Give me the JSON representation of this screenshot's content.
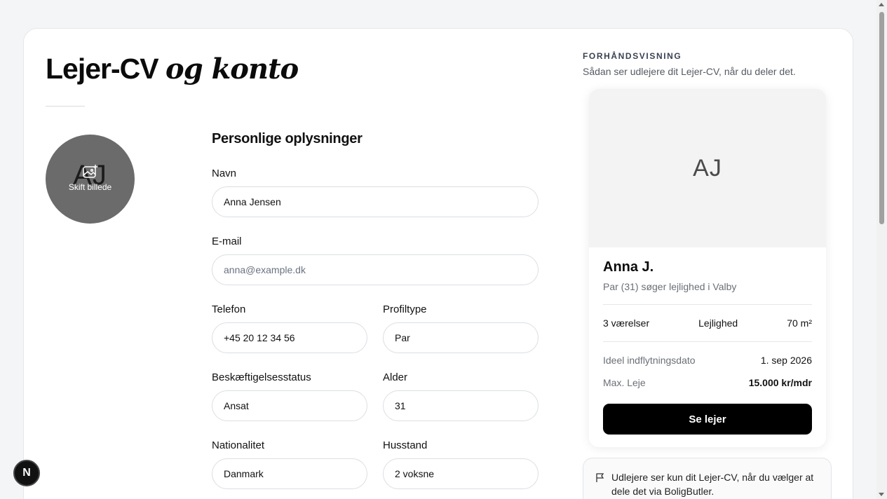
{
  "page": {
    "title_plain": "Lejer-CV",
    "title_italic": "og konto"
  },
  "avatar": {
    "initials": "AJ",
    "change_label": "Skift billede"
  },
  "form": {
    "section_title": "Personlige oplysninger",
    "fields": {
      "name": {
        "label": "Navn",
        "value": "Anna Jensen"
      },
      "email": {
        "label": "E-mail",
        "placeholder": "anna@example.dk"
      },
      "phone": {
        "label": "Telefon",
        "value": "+45 20 12 34 56"
      },
      "profile_type": {
        "label": "Profiltype",
        "value": "Par"
      },
      "employment": {
        "label": "Beskæftigelsesstatus",
        "value": "Ansat"
      },
      "age": {
        "label": "Alder",
        "value": "31"
      },
      "nationality": {
        "label": "Nationalitet",
        "value": "Danmark"
      },
      "household": {
        "label": "Husstand",
        "value": "2 voksne"
      }
    }
  },
  "preview": {
    "label": "FORHÅNDSVISNING",
    "subtitle": "Sådan ser udlejere dit Lejer-CV, når du deler det.",
    "card": {
      "initials": "AJ",
      "name": "Anna J.",
      "description": "Par (31) søger lejlighed i Valby",
      "rooms": "3 værelser",
      "housing_type": "Lejlighed",
      "size": "70 m²",
      "move_in_label": "Ideel indflytningsdato",
      "move_in_value": "1. sep 2026",
      "max_rent_label": "Max. Leje",
      "max_rent_value": "15.000 kr/mdr",
      "button_label": "Se lejer"
    },
    "note": "Udlejere ser kun dit Lejer-CV, når du vælger at dele det via BoligButler."
  },
  "badge": {
    "letter": "N"
  }
}
